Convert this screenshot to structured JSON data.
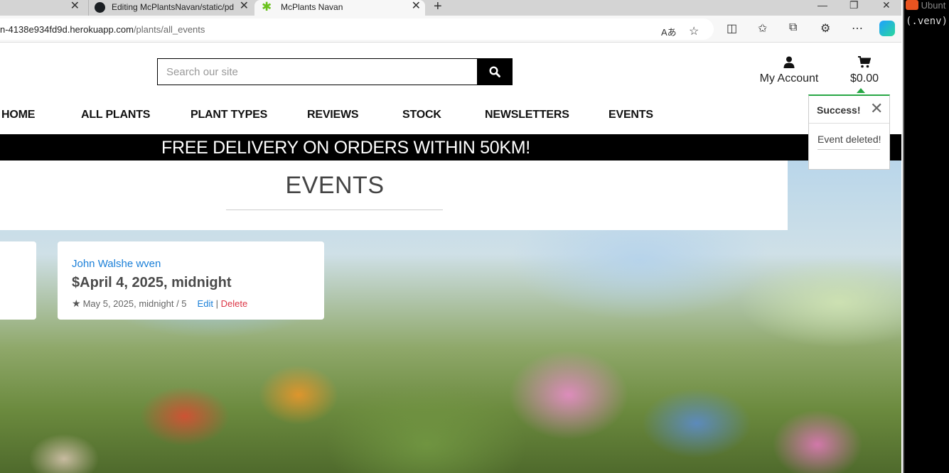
{
  "browser": {
    "tabs": [
      {
        "title": "",
        "close": "✕"
      },
      {
        "title": "Editing McPlantsNavan/static/pd",
        "close": "✕"
      },
      {
        "title": "McPlants Navan",
        "close": "✕"
      }
    ],
    "new_tab": "+",
    "window_controls": [
      "—",
      "❐",
      "✕"
    ],
    "url_host": "n-4138e934fd9d.herokuapp.com",
    "url_path": "/plants/all_events",
    "toolbar_icons": [
      "read-aloud-icon",
      "favorite-star-icon",
      "split-screen-icon",
      "favorites-icon",
      "collections-icon",
      "extensions-icon",
      "more-icon",
      "copilot-icon"
    ]
  },
  "terminal": {
    "title": "Ubunt",
    "line": "(.venv)"
  },
  "header": {
    "search_placeholder": "Search our site",
    "account_label": "My Account",
    "cart_total": "$0.00"
  },
  "nav": [
    "HOME",
    "ALL PLANTS",
    "PLANT TYPES",
    "REVIEWS",
    "STOCK",
    "NEWSLETTERS",
    "EVENTS"
  ],
  "banner": "FREE DELIVERY ON ORDERS WITHIN 50KM!",
  "events": {
    "title": "EVENTS",
    "cards": [
      {
        "host": "John Walshe wven",
        "date": "$April 4, 2025, midnight",
        "meta": "May 5, 2025, midnight / 5",
        "edit": "Edit",
        "sep": "|",
        "delete": "Delete"
      }
    ]
  },
  "toast": {
    "title": "Success!",
    "close": "✕",
    "message": "Event deleted!"
  },
  "colors": {
    "link": "#1a7fd8",
    "danger": "#dc3545",
    "success": "#28a745"
  }
}
